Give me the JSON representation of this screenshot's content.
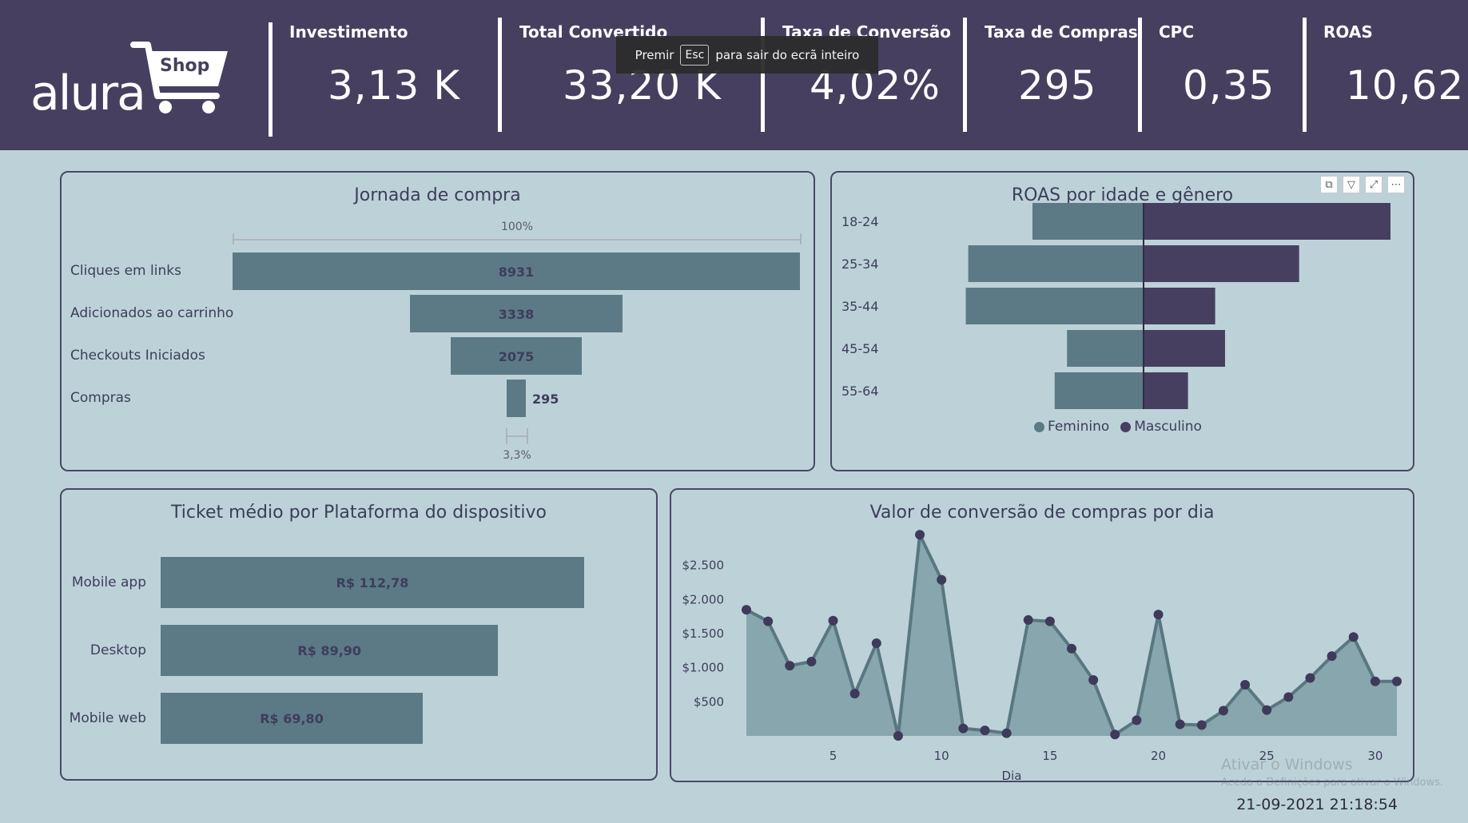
{
  "logo": {
    "word": "alura",
    "badge": "Shop"
  },
  "kpis": [
    {
      "label": "Investimento",
      "value": "3,13 K"
    },
    {
      "label": "Total Convertido",
      "value": "33,20 K"
    },
    {
      "label": "Taxa de Conversão",
      "value": "4,02%"
    },
    {
      "label": "Taxa de Compras",
      "value": "295"
    },
    {
      "label": "CPC",
      "value": "0,35"
    },
    {
      "label": "ROAS",
      "value": "10,62"
    }
  ],
  "fullscreen_toast": {
    "before": "Premir",
    "key": "Esc",
    "after": "para sair do ecrã inteiro"
  },
  "funnel": {
    "title": "Jornada de compra",
    "top_pct": "100%",
    "bottom_pct": "3,3%",
    "stages": [
      {
        "label": "Cliques em links",
        "value": 8931
      },
      {
        "label": "Adicionados ao carrinho",
        "value": 3338
      },
      {
        "label": "Checkouts Iniciados",
        "value": 2075
      },
      {
        "label": "Compras",
        "value": 295
      }
    ]
  },
  "roas": {
    "title": "ROAS por idade e gênero",
    "tools": [
      "copy-icon",
      "filter-icon",
      "focus-mode-icon",
      "more-options-icon"
    ],
    "legend": [
      {
        "label": "Feminino",
        "color": "#5c7a85"
      },
      {
        "label": "Masculino",
        "color": "#463f5f"
      }
    ]
  },
  "ticket": {
    "title": "Ticket médio por Plataforma do dispositivo"
  },
  "daily": {
    "title": "Valor de conversão de compras por dia"
  },
  "chart_data": [
    {
      "type": "bar",
      "orientation": "horizontal",
      "diverging": true,
      "title": "ROAS por idade e gênero",
      "categories": [
        "18-24",
        "25-34",
        "35-44",
        "45-54",
        "55-64"
      ],
      "series": [
        {
          "name": "Feminino",
          "values": [
            4.5,
            7.1,
            7.2,
            3.1,
            3.6
          ]
        },
        {
          "name": "Masculino",
          "values": [
            10.0,
            6.3,
            2.9,
            3.3,
            1.8
          ]
        }
      ],
      "legend_position": "bottom"
    },
    {
      "type": "bar",
      "orientation": "horizontal",
      "title": "Ticket médio por Plataforma do dispositivo",
      "categories": [
        "Mobile app",
        "Desktop",
        "Mobile web"
      ],
      "values": [
        112.78,
        89.9,
        69.8
      ],
      "value_labels": [
        "R$ 112,78",
        "R$ 89,90",
        "R$ 69,80"
      ],
      "xlim": [
        0,
        112.78
      ]
    },
    {
      "type": "area",
      "title": "Valor de conversão de compras por dia",
      "xlabel": "Dia",
      "ylabel": "",
      "x": [
        1,
        2,
        3,
        4,
        5,
        6,
        7,
        8,
        9,
        10,
        11,
        12,
        13,
        14,
        15,
        16,
        17,
        18,
        19,
        20,
        21,
        22,
        23,
        24,
        25,
        26,
        27,
        28,
        29,
        30,
        31
      ],
      "y": [
        1850,
        1680,
        1030,
        1090,
        1690,
        620,
        1360,
        0,
        2950,
        2290,
        110,
        80,
        40,
        1700,
        1680,
        1280,
        820,
        20,
        230,
        1780,
        170,
        160,
        370,
        750,
        380,
        570,
        850,
        1170,
        1450,
        800,
        800
      ],
      "xticks": [
        5,
        10,
        15,
        20,
        25,
        30
      ],
      "yticks": [
        500,
        1000,
        1500,
        2000,
        2500
      ],
      "ytick_labels": [
        "$500",
        "$1.000",
        "$1.500",
        "$2.000",
        "$2.500"
      ],
      "grid": false
    }
  ],
  "footer": {
    "datetime": "21-09-2021 21:18:54",
    "watermark_title": "Ativar o Windows",
    "watermark_sub": "Aceda a Definições para ativar o Windows."
  }
}
